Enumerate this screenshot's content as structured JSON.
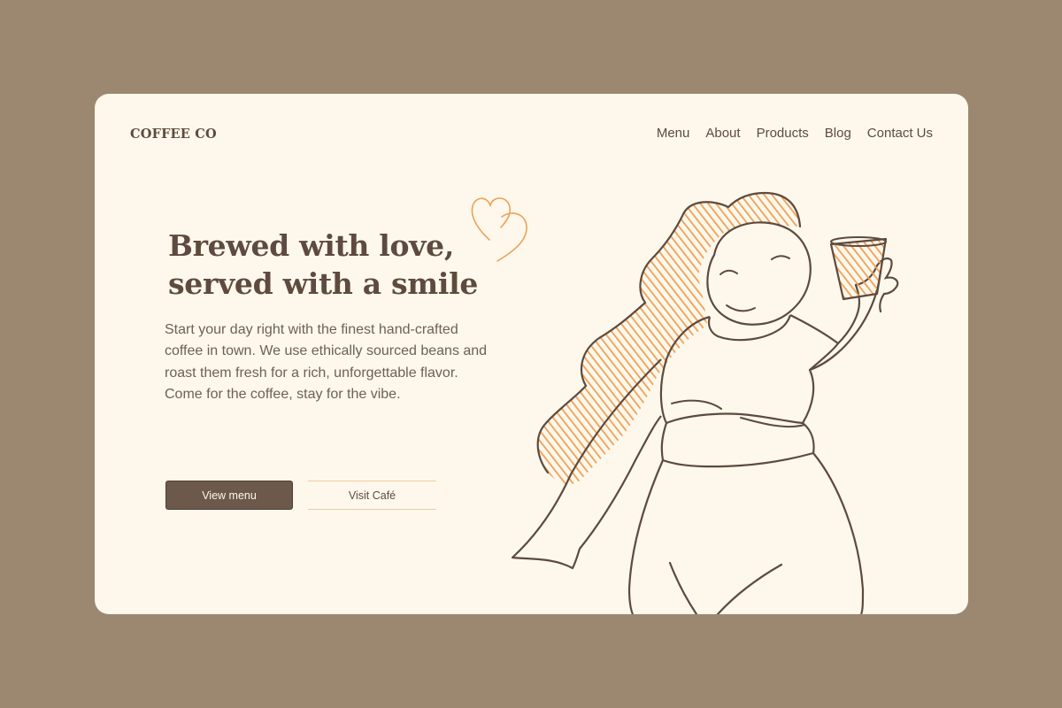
{
  "brand": {
    "name": "COFFEE CO"
  },
  "nav": {
    "items": [
      {
        "label": "Menu"
      },
      {
        "label": "About"
      },
      {
        "label": "Products"
      },
      {
        "label": "Blog"
      },
      {
        "label": "Contact Us"
      }
    ]
  },
  "hero": {
    "headline_line1": "Brewed with love,",
    "headline_line2": "served with a smile",
    "description": "Start your day right with the finest hand-crafted coffee in town. We use ethically sourced beans and roast them fresh for a rich, unforgettable flavor. Come for the coffee, stay for the vibe.",
    "primary_button": "View menu",
    "secondary_button": "Visit Café"
  },
  "colors": {
    "page_background": "#9c8870",
    "card_background": "#fdf8eb",
    "text_brown": "#5e4a3e",
    "accent_orange": "#f0a058",
    "button_brown": "#6c594b"
  },
  "illustration": {
    "heart_icon": "heart-icon",
    "figure": "woman-holding-coffee-cup"
  }
}
